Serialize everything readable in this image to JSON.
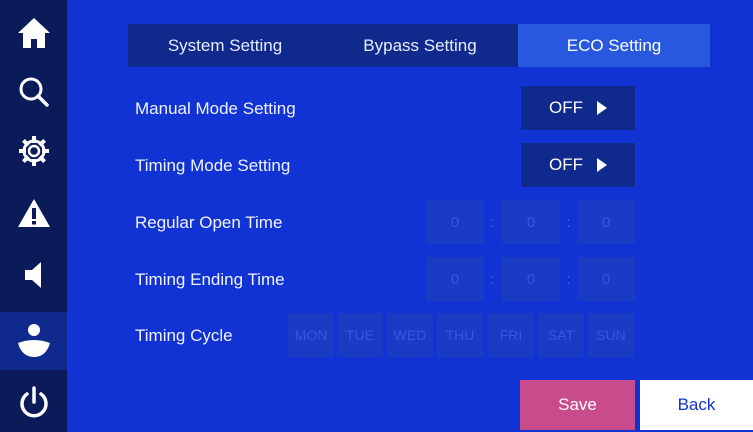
{
  "sidebar": {
    "items": [
      {
        "icon": "home-icon"
      },
      {
        "icon": "search-icon"
      },
      {
        "icon": "gear-icon"
      },
      {
        "icon": "warning-icon"
      },
      {
        "icon": "speaker-icon"
      },
      {
        "icon": "user-icon"
      },
      {
        "icon": "power-icon"
      }
    ]
  },
  "tabs": [
    {
      "label": "System Setting"
    },
    {
      "label": "Bypass Setting"
    },
    {
      "label": "ECO Setting"
    }
  ],
  "manual_mode": {
    "label": "Manual Mode Setting",
    "value": "OFF"
  },
  "timing_mode": {
    "label": "Timing Mode Setting",
    "value": "OFF"
  },
  "regular_open": {
    "label": "Regular Open Time",
    "h": "0",
    "m": "0",
    "s": "0",
    "sep": ":"
  },
  "timing_end": {
    "label": "Timing Ending Time",
    "h": "0",
    "m": "0",
    "s": "0",
    "sep": ":"
  },
  "timing_cycle": {
    "label": "Timing Cycle",
    "days": [
      "MON",
      "TUE",
      "WED",
      "THU",
      "FRI",
      "SAT",
      "SUN"
    ]
  },
  "actions": {
    "save": "Save",
    "back": "Back"
  },
  "colors": {
    "background": "#1233d4",
    "sidebar": "#0b1a59",
    "active_tab": "#2857e0",
    "save": "#c84b8c"
  }
}
